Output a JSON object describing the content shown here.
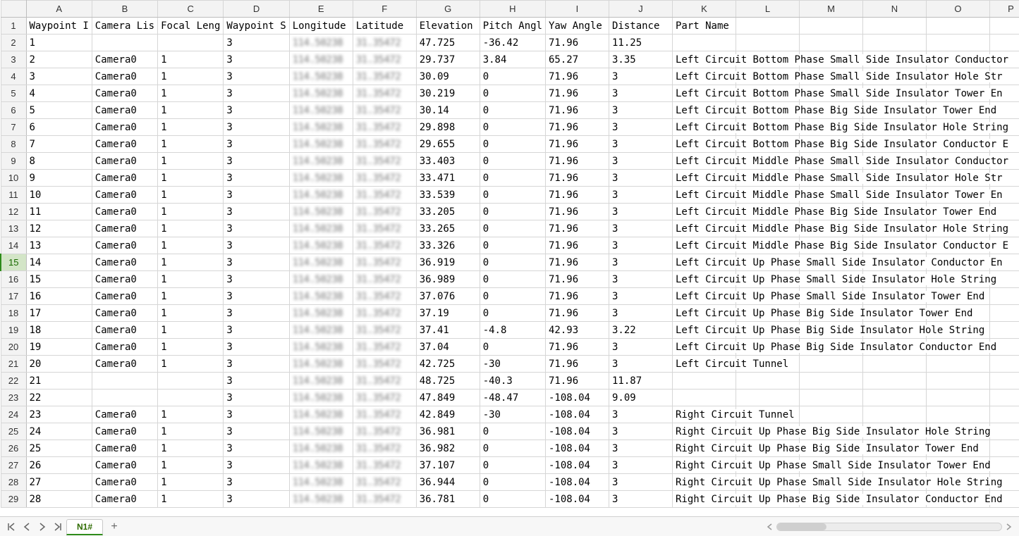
{
  "columns": [
    "A",
    "B",
    "C",
    "D",
    "E",
    "F",
    "G",
    "H",
    "I",
    "J",
    "K",
    "L",
    "M",
    "N",
    "O",
    "P"
  ],
  "headers": {
    "A": "Waypoint I",
    "B": "Camera Lis",
    "C": "Focal Leng",
    "D": "Waypoint S",
    "E": "Longitude",
    "F": "Latitude",
    "G": "Elevation",
    "H": "Pitch Angl",
    "I": "Yaw Angle",
    "J": "Distance",
    "K": "Part Name"
  },
  "rows": [
    {
      "n": 1,
      "A": 1,
      "D": 3,
      "G": 47.725,
      "H": -36.42,
      "I": 71.96,
      "J": 11.25
    },
    {
      "n": 2,
      "A": 2,
      "B": "Camera0",
      "C": 1,
      "D": 3,
      "G": 29.737,
      "H": 3.84,
      "I": 65.27,
      "J": 3.35,
      "K": "Left Circuit Bottom Phase Small Side Insulator Conductor"
    },
    {
      "n": 3,
      "A": 3,
      "B": "Camera0",
      "C": 1,
      "D": 3,
      "G": 30.09,
      "H": 0,
      "I": 71.96,
      "J": 3,
      "K": "Left Circuit Bottom Phase Small Side Insulator Hole Str"
    },
    {
      "n": 4,
      "A": 4,
      "B": "Camera0",
      "C": 1,
      "D": 3,
      "G": 30.219,
      "H": 0,
      "I": 71.96,
      "J": 3,
      "K": "Left Circuit Bottom Phase Small Side Insulator Tower En"
    },
    {
      "n": 5,
      "A": 5,
      "B": "Camera0",
      "C": 1,
      "D": 3,
      "G": 30.14,
      "H": 0,
      "I": 71.96,
      "J": 3,
      "K": "Left Circuit Bottom Phase Big Side Insulator Tower End"
    },
    {
      "n": 6,
      "A": 6,
      "B": "Camera0",
      "C": 1,
      "D": 3,
      "G": 29.898,
      "H": 0,
      "I": 71.96,
      "J": 3,
      "K": "Left Circuit Bottom Phase Big Side Insulator Hole String"
    },
    {
      "n": 7,
      "A": 7,
      "B": "Camera0",
      "C": 1,
      "D": 3,
      "G": 29.655,
      "H": 0,
      "I": 71.96,
      "J": 3,
      "K": "Left Circuit Bottom Phase Big Side Insulator Conductor E"
    },
    {
      "n": 8,
      "A": 8,
      "B": "Camera0",
      "C": 1,
      "D": 3,
      "G": 33.403,
      "H": 0,
      "I": 71.96,
      "J": 3,
      "K": "Left Circuit Middle Phase Small Side Insulator Conductor"
    },
    {
      "n": 9,
      "A": 9,
      "B": "Camera0",
      "C": 1,
      "D": 3,
      "G": 33.471,
      "H": 0,
      "I": 71.96,
      "J": 3,
      "K": "Left Circuit Middle Phase Small Side Insulator Hole Str"
    },
    {
      "n": 10,
      "A": 10,
      "B": "Camera0",
      "C": 1,
      "D": 3,
      "G": 33.539,
      "H": 0,
      "I": 71.96,
      "J": 3,
      "K": "Left Circuit Middle Phase Small Side Insulator Tower En"
    },
    {
      "n": 11,
      "A": 11,
      "B": "Camera0",
      "C": 1,
      "D": 3,
      "G": 33.205,
      "H": 0,
      "I": 71.96,
      "J": 3,
      "K": "Left Circuit Middle Phase Big Side Insulator Tower End"
    },
    {
      "n": 12,
      "A": 12,
      "B": "Camera0",
      "C": 1,
      "D": 3,
      "G": 33.265,
      "H": 0,
      "I": 71.96,
      "J": 3,
      "K": "Left Circuit Middle Phase Big Side Insulator Hole String"
    },
    {
      "n": 13,
      "A": 13,
      "B": "Camera0",
      "C": 1,
      "D": 3,
      "G": 33.326,
      "H": 0,
      "I": 71.96,
      "J": 3,
      "K": "Left Circuit Middle Phase Big Side Insulator Conductor E"
    },
    {
      "n": 14,
      "A": 14,
      "B": "Camera0",
      "C": 1,
      "D": 3,
      "G": 36.919,
      "H": 0,
      "I": 71.96,
      "J": 3,
      "K": "Left Circuit Up Phase Small Side Insulator Conductor En"
    },
    {
      "n": 15,
      "A": 15,
      "B": "Camera0",
      "C": 1,
      "D": 3,
      "G": 36.989,
      "H": 0,
      "I": 71.96,
      "J": 3,
      "K": "Left Circuit Up Phase Small Side Insulator Hole String"
    },
    {
      "n": 16,
      "A": 16,
      "B": "Camera0",
      "C": 1,
      "D": 3,
      "G": 37.076,
      "H": 0,
      "I": 71.96,
      "J": 3,
      "K": "Left Circuit Up Phase Small Side Insulator Tower End"
    },
    {
      "n": 17,
      "A": 17,
      "B": "Camera0",
      "C": 1,
      "D": 3,
      "G": 37.19,
      "H": 0,
      "I": 71.96,
      "J": 3,
      "K": "Left Circuit Up Phase Big Side Insulator Tower End"
    },
    {
      "n": 18,
      "A": 18,
      "B": "Camera0",
      "C": 1,
      "D": 3,
      "G": 37.41,
      "H": -4.8,
      "I": 42.93,
      "J": 3.22,
      "K": "Left Circuit Up Phase Big Side Insulator Hole String"
    },
    {
      "n": 19,
      "A": 19,
      "B": "Camera0",
      "C": 1,
      "D": 3,
      "G": 37.04,
      "H": 0,
      "I": 71.96,
      "J": 3,
      "K": "Left Circuit Up Phase Big Side Insulator Conductor End"
    },
    {
      "n": 20,
      "A": 20,
      "B": "Camera0",
      "C": 1,
      "D": 3,
      "G": 42.725,
      "H": -30,
      "I": 71.96,
      "J": 3,
      "K": "Left Circuit Tunnel"
    },
    {
      "n": 21,
      "A": 21,
      "D": 3,
      "G": 48.725,
      "H": -40.3,
      "I": 71.96,
      "J": 11.87
    },
    {
      "n": 22,
      "A": 22,
      "D": 3,
      "G": 47.849,
      "H": -48.47,
      "I": -108.04,
      "J": 9.09
    },
    {
      "n": 23,
      "A": 23,
      "B": "Camera0",
      "C": 1,
      "D": 3,
      "G": 42.849,
      "H": -30,
      "I": -108.04,
      "J": 3,
      "K": "Right Circuit Tunnel"
    },
    {
      "n": 24,
      "A": 24,
      "B": "Camera0",
      "C": 1,
      "D": 3,
      "G": 36.981,
      "H": 0,
      "I": -108.04,
      "J": 3,
      "K": "Right Circuit Up Phase Big Side Insulator Hole String"
    },
    {
      "n": 25,
      "A": 25,
      "B": "Camera0",
      "C": 1,
      "D": 3,
      "G": 36.982,
      "H": 0,
      "I": -108.04,
      "J": 3,
      "K": "Right Circuit Up Phase Big Side Insulator Tower End"
    },
    {
      "n": 26,
      "A": 26,
      "B": "Camera0",
      "C": 1,
      "D": 3,
      "G": 37.107,
      "H": 0,
      "I": -108.04,
      "J": 3,
      "K": "Right Circuit Up Phase Small Side Insulator Tower End"
    },
    {
      "n": 27,
      "A": 27,
      "B": "Camera0",
      "C": 1,
      "D": 3,
      "G": 36.944,
      "H": 0,
      "I": -108.04,
      "J": 3,
      "K": "Right Circuit Up Phase Small Side Insulator Hole String"
    },
    {
      "n": 28,
      "A": 28,
      "B": "Camera0",
      "C": 1,
      "D": 3,
      "G": 36.781,
      "H": 0,
      "I": -108.04,
      "J": 3,
      "K": "Right Circuit Up Phase Big Side Insulator Conductor End"
    }
  ],
  "selected_row": 15,
  "tab": {
    "name": "N1#"
  },
  "blur_placeholder_lon": "114.50238",
  "blur_placeholder_lat": "31.35472"
}
